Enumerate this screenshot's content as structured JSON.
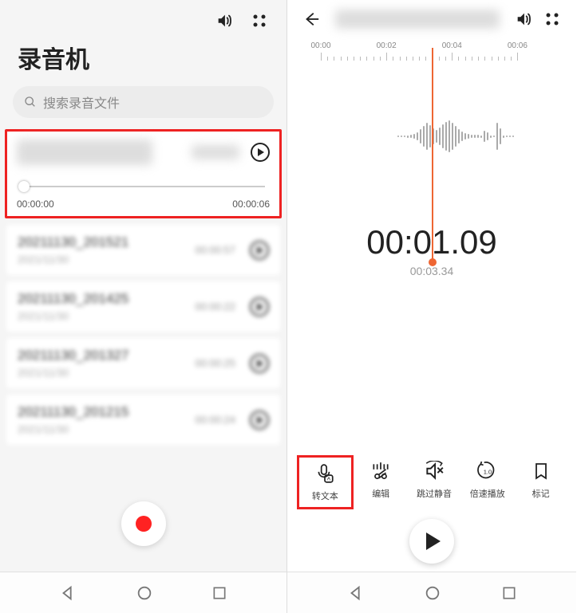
{
  "left": {
    "title": "录音机",
    "search_placeholder": "搜索录音文件",
    "selected": {
      "start_time": "00:00:00",
      "end_time": "00:00:06"
    },
    "recordings": [
      {
        "name": "20211130_201521",
        "date": "2021/11/30",
        "duration": "00:00:57"
      },
      {
        "name": "20211130_201425",
        "date": "2021/11/30",
        "duration": "00:00:22"
      },
      {
        "name": "20211130_201327",
        "date": "2021/11/30",
        "duration": "00:00:25"
      },
      {
        "name": "20211130_201215",
        "date": "2021/11/30",
        "duration": "00:00:24"
      }
    ]
  },
  "right": {
    "ruler_ticks": [
      "00:00",
      "00:02",
      "00:04",
      "00:06"
    ],
    "current_time": "00:01.09",
    "total_time": "00:03.34",
    "tools": {
      "transcribe": "转文本",
      "edit": "编辑",
      "skip_silence": "跳过静音",
      "speed": "倍速播放",
      "bookmark": "标记"
    },
    "speed_value": "1.0"
  }
}
